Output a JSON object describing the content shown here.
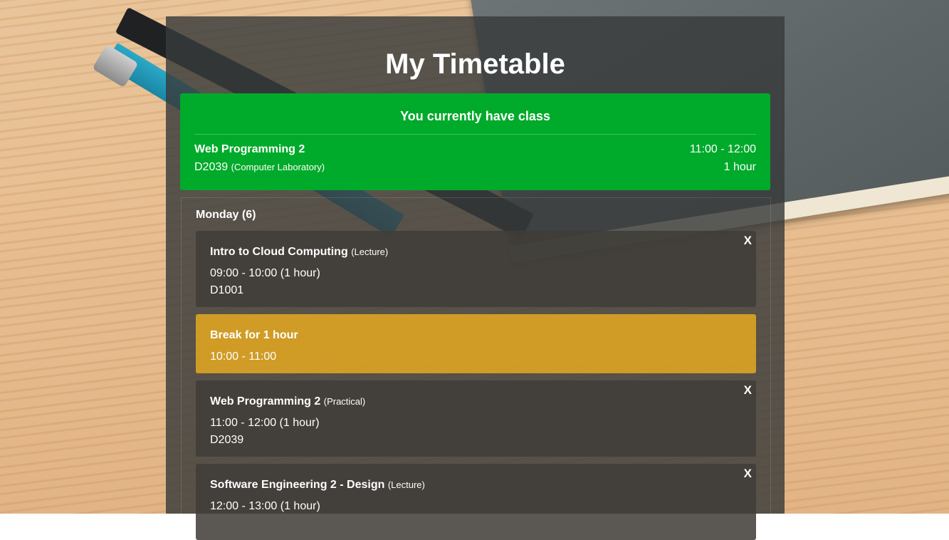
{
  "page": {
    "title": "My Timetable"
  },
  "current_class": {
    "heading": "You currently have class",
    "name": "Web Programming 2",
    "room": "D2039",
    "room_type": "(Computer Laboratory)",
    "time": "11:00 - 12:00",
    "duration": "1 hour"
  },
  "day": {
    "title": "Monday (6)",
    "entries": [
      {
        "kind": "class",
        "name": "Intro to Cloud Computing",
        "type": "(Lecture)",
        "time": "09:00 - 10:00 (1 hour)",
        "room": "D1001",
        "close_label": "X"
      },
      {
        "kind": "break",
        "name": "Break for 1 hour",
        "time": "10:00 - 11:00"
      },
      {
        "kind": "class",
        "name": "Web Programming 2",
        "type": "(Practical)",
        "time": "11:00 - 12:00 (1 hour)",
        "room": "D2039",
        "close_label": "X"
      },
      {
        "kind": "class",
        "name": "Software Engineering 2 - Design",
        "type": "(Lecture)",
        "time": "12:00 - 13:00 (1 hour)",
        "room": "",
        "close_label": "X"
      }
    ]
  },
  "colors": {
    "current_class_bg": "#00aa2a",
    "break_bg": "#eaac1e",
    "card_bg": "#403c38",
    "panel_bg": "#383a3a"
  }
}
